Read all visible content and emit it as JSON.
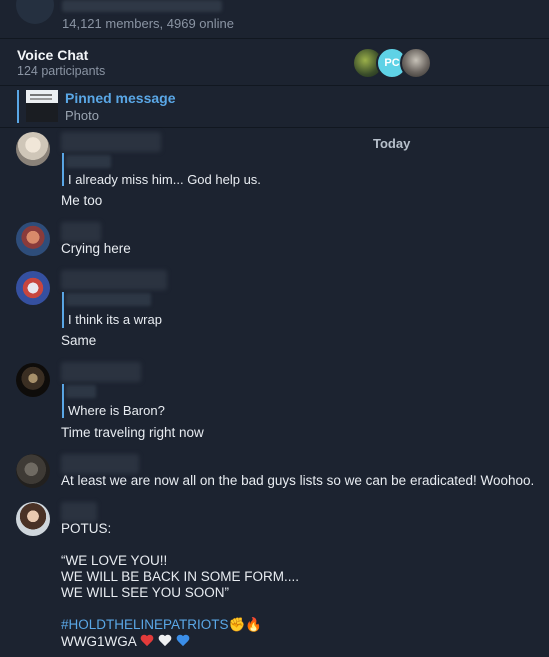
{
  "header": {
    "members_text": "14,121 members, 4969 online"
  },
  "voice_chat": {
    "title": "Voice Chat",
    "participants": "124 participants",
    "avatar_initials": "PC"
  },
  "pinned": {
    "title": "Pinned message",
    "subtitle": "Photo"
  },
  "date_label": "Today",
  "messages": [
    {
      "reply_text": "I already miss him... God help us.",
      "text": "Me too"
    },
    {
      "text": "Crying here"
    },
    {
      "reply_text": "I think its a wrap",
      "text": "Same"
    },
    {
      "reply_text": "Where is Baron?",
      "text": "Time traveling right now"
    },
    {
      "text": "At least we are now all on the bad guys lists so we can be eradicated! Woohoo."
    },
    {
      "line1": "POTUS:",
      "line2": "“WE LOVE YOU!!",
      "line3": "WE WILL BE BACK IN SOME FORM....",
      "line4": "WE WILL SEE YOU SOON”",
      "hashtag": "#HOLDTHELINEPATRIOTS",
      "sign": "WWG1WGA"
    }
  ],
  "colors": {
    "background": "#1c2330",
    "accent": "#5aa7e6",
    "text": "#e8ecf1",
    "muted": "#8a94a3"
  }
}
